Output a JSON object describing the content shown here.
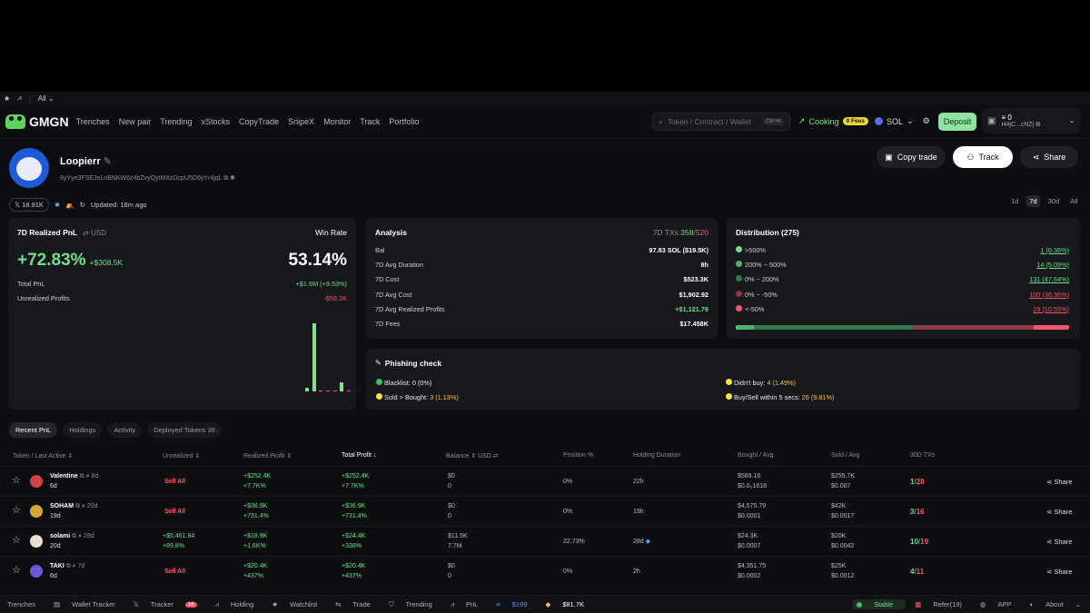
{
  "browser_tabs": {
    "all_label": "All"
  },
  "nav": {
    "logo": "GMGN",
    "links": [
      "Trenches",
      "New pair",
      "Trending",
      "xStocks",
      "CopyTrade",
      "SnipeX",
      "Monitor",
      "Track",
      "Portfolio"
    ],
    "search_placeholder": "Token / Contract / Wallet",
    "search_shortcut": "Ctrl+K",
    "cooking_label": "Cooking",
    "fees_badge": "0 Fees",
    "chain": "SOL",
    "deposit": "Deposit",
    "wallet_balance": "0",
    "wallet_addr": "H4jC...cNZj"
  },
  "profile": {
    "name": "Loopierr",
    "address": "9yYye3FSEJoLnBNKW6z4bZvyQytMXzDcpU5D6yYr4jqL",
    "x_followers": "18.91K",
    "updated": "Updated: 18m ago",
    "copy_trade": "Copy trade",
    "track": "Track",
    "share": "Share",
    "periods": [
      "1d",
      "7d",
      "30d",
      "All"
    ],
    "active_period": "7d"
  },
  "pnl_card": {
    "title": "7D Realized PnL",
    "currency": "USD",
    "win_rate_label": "Win Rate",
    "pnl_pct": "+72.83%",
    "pnl_usd": "+$308.5K",
    "win_rate": "53.14%",
    "total_pnl_label": "Total PnL",
    "total_pnl": "+$1.6M (+9.53%)",
    "unrealized_label": "Unrealized Profits",
    "unrealized": "-$56.2K",
    "bars": [
      0.05,
      1.0,
      0.02,
      0.02,
      0.02,
      0.14,
      0.02
    ]
  },
  "analysis": {
    "title": "Analysis",
    "tx_label": "7D TXs:",
    "tx_buy": "358",
    "tx_sell": "520",
    "rows": [
      {
        "label": "Bal",
        "value": "97.83 SOL ($19.5K)",
        "cls": ""
      },
      {
        "label": "7D Avg Duration",
        "value": "8h",
        "cls": ""
      },
      {
        "label": "7D Cost",
        "value": "$523.3K",
        "cls": ""
      },
      {
        "label": "7D Avg Cost",
        "value": "$1,902.92",
        "cls": ""
      },
      {
        "label": "7D Avg Realized Profits",
        "value": "+$1,121.79",
        "cls": "pos"
      },
      {
        "label": "7D Fees",
        "value": "$17.458K",
        "cls": ""
      }
    ]
  },
  "distribution": {
    "title": "Distribution (275)",
    "rows": [
      {
        "label": ">500%",
        "value": "1 (0.36%)",
        "color": "#6fdf8c"
      },
      {
        "label": "200% ~ 500%",
        "value": "14 (5.09%)",
        "color": "#4fb070"
      },
      {
        "label": "0% ~ 200%",
        "value": "131 (47.64%)",
        "color": "#2f7a4d"
      },
      {
        "label": "0% ~ -50%",
        "value": "100 (36.36%)",
        "color": "#8a3a48"
      },
      {
        "label": "<-50%",
        "value": "29 (10.55%)",
        "color": "#f3566d"
      }
    ],
    "bar_fractions": [
      0.0036,
      0.0509,
      0.4764,
      0.3636,
      0.1055
    ]
  },
  "phishing": {
    "title": "Phishing check",
    "blacklist_label": "Blacklist:",
    "blacklist_value": "0 (0%)",
    "sold_label": "Sold > Bought:",
    "sold_value": "3 (1.13%)",
    "didnt_buy_label": "Didn't buy:",
    "didnt_buy_value": "4 (1.49%)",
    "buysell_label": "Buy/Sell within 5 secs:",
    "buysell_value": "26 (9.81%)"
  },
  "table_tabs": [
    "Recent PnL",
    "Holdings",
    "Activity",
    "Deployed Tokens 39"
  ],
  "table_headers": {
    "token": "Token / Last Active",
    "unrealized": "Unrealized",
    "realized": "Realized Profit",
    "total": "Total Profit",
    "balance": "Balance",
    "balance_unit": "USD",
    "position": "Position %",
    "holding": "Holding Duration",
    "bought": "Bought / Avg",
    "sold": "Sold / Avg",
    "txs": "30D TXs"
  },
  "rows": [
    {
      "name": "Valentine",
      "age": "8d",
      "last": "6d",
      "unreal1": "Sell All",
      "unreal2": "",
      "real1": "+$252.4K",
      "real2": "+7.7K%",
      "tot1": "+$252.4K",
      "tot2": "+7.7K%",
      "bal1": "$0",
      "bal2": "0",
      "pos": "0%",
      "hold": "22h",
      "b1": "$589.16",
      "b2": "$0.0₅1618",
      "s1": "$255.7K",
      "s2": "$0.007",
      "buys": "1",
      "sells": "28",
      "share": "Share",
      "color": "#c44"
    },
    {
      "name": "SOHAM",
      "age": "20d",
      "last": "19d",
      "unreal1": "Sell All",
      "unreal2": "",
      "real1": "+$36.9K",
      "real2": "+731.4%",
      "tot1": "+$36.9K",
      "tot2": "+731.4%",
      "bal1": "$0",
      "bal2": "0",
      "pos": "0%",
      "hold": "19h",
      "b1": "$4,575.79",
      "b2": "$0.0001",
      "s1": "$42K",
      "s2": "$0.0017",
      "buys": "3",
      "sells": "16",
      "share": "Share",
      "color": "#d4a53a"
    },
    {
      "name": "solami",
      "age": "28d",
      "last": "20d",
      "unreal1": "+$5,461.84",
      "unreal2": "+89.8%",
      "real1": "+$18.9K",
      "real2": "+1.6K%",
      "tot1": "+$24.4K",
      "tot2": "+338%",
      "bal1": "$11.5K",
      "bal2": "7.7M",
      "pos": "22.73%",
      "hold": "28d",
      "b1": "$24.3K",
      "b2": "$0.0007",
      "s1": "$20K",
      "s2": "$0.0042",
      "buys": "10",
      "sells": "19",
      "share": "Share",
      "color": "#e9e0d0"
    },
    {
      "name": "TAKI",
      "age": "7d",
      "last": "6d",
      "unreal1": "Sell All",
      "unreal2": "",
      "real1": "+$20.4K",
      "real2": "+437%",
      "tot1": "+$20.4K",
      "tot2": "+437%",
      "bal1": "$0",
      "bal2": "0",
      "pos": "0%",
      "hold": "2h",
      "b1": "$4,351.75",
      "b2": "$0.0002",
      "s1": "$25K",
      "s2": "$0.0012",
      "buys": "4",
      "sells": "11",
      "share": "Share",
      "color": "#6a5ad8"
    }
  ],
  "footer": {
    "trenches": "Trenches",
    "wallet_tracker": "Wallet Tracker",
    "tracker": "Tracker",
    "tracker_badge": "16",
    "holding": "Holding",
    "watchlist": "Watchlist",
    "trade": "Trade",
    "trending": "Trending",
    "pnl": "PnL",
    "sol_price": "$199",
    "vol": "$81.7K",
    "stable": "Stable",
    "refer": "Refer(19)",
    "app": "APP",
    "about": "About"
  }
}
